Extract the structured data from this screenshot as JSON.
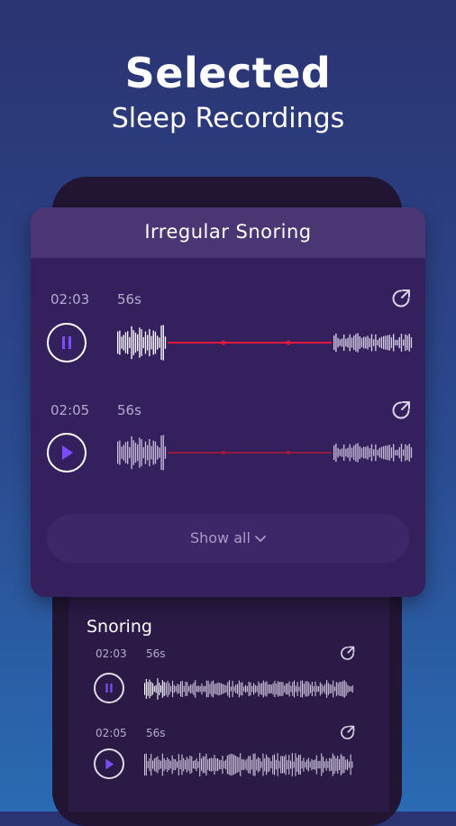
{
  "hero": {
    "title": "Selected",
    "subtitle": "Sleep Recordings"
  },
  "card": {
    "title": "Irregular Snoring",
    "recordings": [
      {
        "time": "02:03",
        "duration": "56s",
        "state": "playing"
      },
      {
        "time": "02:05",
        "duration": "56s",
        "state": "paused"
      }
    ],
    "show_all_label": "Show all"
  },
  "section": {
    "title": "Snoring",
    "recordings": [
      {
        "time": "02:03",
        "duration": "56s",
        "state": "playing"
      },
      {
        "time": "02:05",
        "duration": "56s",
        "state": "paused"
      }
    ]
  },
  "colors": {
    "accent": "#7b4dff",
    "progress": "#e01a3c",
    "wave": "#ffffff"
  },
  "icons": [
    "pause-icon",
    "play-icon",
    "share-icon",
    "chevron-down-icon"
  ]
}
